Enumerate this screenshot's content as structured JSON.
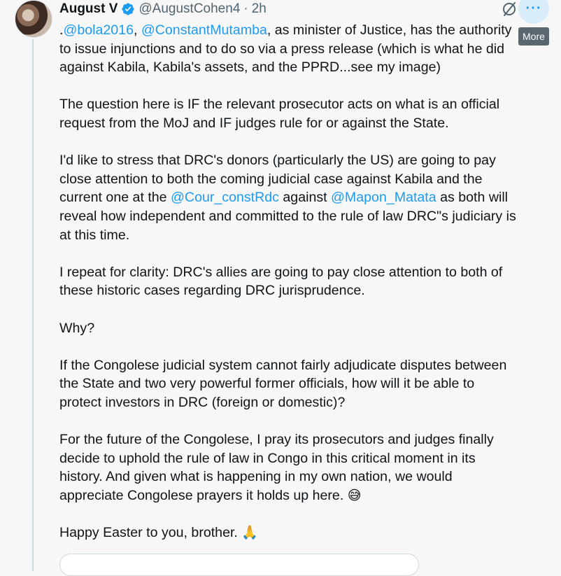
{
  "author": {
    "name": "August V",
    "handle": "@AugustCohen4",
    "separator": "·",
    "time": "2h"
  },
  "more_tooltip": "More",
  "paragraphs": [
    [
      [
        {
          "t": "."
        },
        {
          "t": "@bola2016",
          "m": true
        },
        {
          "t": ", "
        },
        {
          "t": "@ConstantMutamba",
          "m": true
        },
        {
          "t": ", as minister of Justice, has the authority"
        }
      ],
      [
        {
          "t": "to issue injunctions and to do so via a press release (which is what he did"
        }
      ],
      [
        {
          "t": "against Kabila, Kabila's assets, and the PPRD...see my image)"
        }
      ]
    ],
    [
      [
        {
          "t": "The question here is IF the relevant prosecutor acts on what is an official"
        }
      ],
      [
        {
          "t": "request from the MoJ and IF judges rule for or against the State."
        }
      ]
    ],
    [
      [
        {
          "t": "I'd like to stress that DRC's donors (particularly the  US) are going to pay"
        }
      ],
      [
        {
          "t": "close attention to both the coming judicial case against Kabila and the"
        }
      ],
      [
        {
          "t": "current one at the "
        },
        {
          "t": "@Cour_constRdc",
          "m": true
        },
        {
          "t": " against "
        },
        {
          "t": "@Mapon_Matata",
          "m": true
        },
        {
          "t": " as both will"
        }
      ],
      [
        {
          "t": "reveal how independent and committed to the rule of law DRC\"s judiciary is"
        }
      ],
      [
        {
          "t": "at this time."
        }
      ]
    ],
    [
      [
        {
          "t": "I repeat for clarity: DRC's allies are going to pay close attention to both of"
        }
      ],
      [
        {
          "t": "these historic cases regarding DRC jurisprudence."
        }
      ]
    ],
    [
      [
        {
          "t": "Why?"
        }
      ]
    ],
    [
      [
        {
          "t": "If the Congolese judicial system cannot fairly adjudicate disputes between"
        }
      ],
      [
        {
          "t": "the State and two very powerful former officials, how will it be able to"
        }
      ],
      [
        {
          "t": "protect investors in DRC (foreign or domestic)?"
        }
      ]
    ],
    [
      [
        {
          "t": "For the future of the Congolese, I pray its prosecutors and judges finally"
        }
      ],
      [
        {
          "t": "decide to uphold the rule of law in Congo in this critical moment in its"
        }
      ],
      [
        {
          "t": "history.  And given what is happening in my own nation, we would"
        }
      ],
      [
        {
          "t": "appreciate Congolese prayers it holds up here. "
        },
        {
          "t": "😅",
          "e": true
        }
      ]
    ],
    [
      [
        {
          "t": "Happy Easter to you, brother. "
        },
        {
          "t": "🙏",
          "e": true
        }
      ]
    ]
  ],
  "icons": {
    "verified": "verified-badge-icon",
    "grok": "grok-icon",
    "more": "more-icon"
  },
  "colors": {
    "link": "#1d9bf0",
    "text": "#0f1419",
    "secondary": "#536471",
    "background": "#f7f7f7"
  }
}
